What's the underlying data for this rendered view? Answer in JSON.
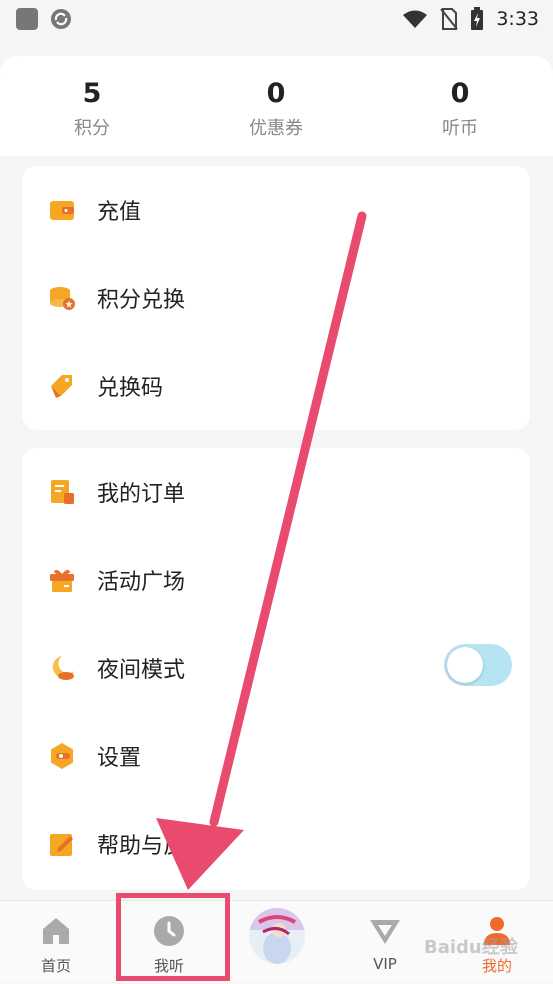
{
  "status_bar": {
    "time": "3:33"
  },
  "stats": [
    {
      "value": "5",
      "label": "积分"
    },
    {
      "value": "0",
      "label": "优惠券"
    },
    {
      "value": "0",
      "label": "听币"
    }
  ],
  "menu_group_1": [
    {
      "label": "充值",
      "icon": "wallet-icon"
    },
    {
      "label": "积分兑换",
      "icon": "coins-exchange-icon"
    },
    {
      "label": "兑换码",
      "icon": "tag-icon"
    }
  ],
  "menu_group_2": [
    {
      "label": "我的订单",
      "icon": "order-icon"
    },
    {
      "label": "活动广场",
      "icon": "gift-icon"
    },
    {
      "label": "夜间模式",
      "icon": "moon-icon",
      "toggle": false
    },
    {
      "label": "设置",
      "icon": "settings-icon"
    },
    {
      "label": "帮助与反",
      "icon": "edit-icon"
    }
  ],
  "tabs": [
    {
      "label": "首页",
      "icon": "home-icon",
      "active": false
    },
    {
      "label": "我听",
      "icon": "clock-icon",
      "active": false
    },
    {
      "label": "",
      "icon": "book-cover",
      "active": false
    },
    {
      "label": "VIP",
      "icon": "vip-icon",
      "active": false
    },
    {
      "label": "我的",
      "icon": "profile-icon",
      "active": true
    }
  ],
  "watermark": "Baidu经验",
  "colors": {
    "accent": "#f5a623",
    "active_tab": "#f06a2b",
    "annotation": "#e94b6f",
    "toggle_track": "#b7e4f3"
  }
}
